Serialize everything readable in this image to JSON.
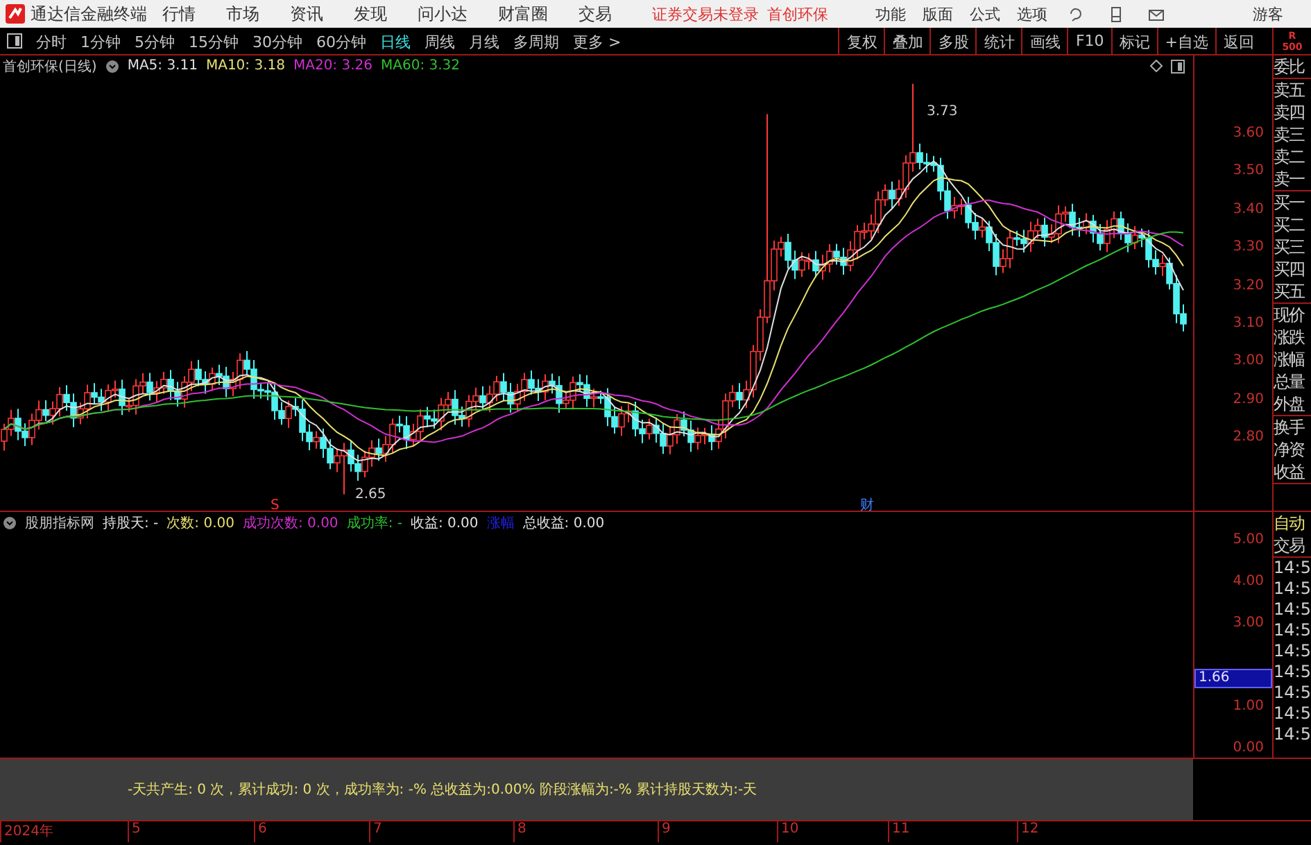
{
  "menu_bar": {
    "app_title": "通达信金融终端",
    "menus": [
      "行情",
      "市场",
      "资讯",
      "发现",
      "问小达",
      "财富圈",
      "交易"
    ],
    "login_status": "证券交易未登录",
    "stock_name": "首创环保",
    "right_menus": [
      "功能",
      "版面",
      "公式",
      "选项"
    ],
    "user": "游客"
  },
  "period_tabs": [
    {
      "label": "分时",
      "selected": false
    },
    {
      "label": "1分钟",
      "selected": false
    },
    {
      "label": "5分钟",
      "selected": false
    },
    {
      "label": "15分钟",
      "selected": false
    },
    {
      "label": "30分钟",
      "selected": false
    },
    {
      "label": "60分钟",
      "selected": false
    },
    {
      "label": "日线",
      "selected": true
    },
    {
      "label": "周线",
      "selected": false
    },
    {
      "label": "月线",
      "selected": false
    },
    {
      "label": "多周期",
      "selected": false
    },
    {
      "label": "更多 >",
      "selected": false
    }
  ],
  "toolbar_buttons": [
    "复权",
    "叠加",
    "多股",
    "统计",
    "画线",
    "F10",
    "标记",
    "+自选",
    "返回"
  ],
  "corner_badge": {
    "letter": "R",
    "number": "500"
  },
  "main_chart": {
    "title": "首创环保(日线)",
    "moving_averages": [
      {
        "label": "MA5: 3.11",
        "color": "#e0e0e0"
      },
      {
        "label": "MA10: 3.18",
        "color": "#e8e070"
      },
      {
        "label": "MA20: 3.26",
        "color": "#d030d0"
      },
      {
        "label": "MA60: 3.32",
        "color": "#30c030"
      }
    ],
    "yticks": [
      "3.60",
      "3.50",
      "3.40",
      "3.30",
      "3.20",
      "3.10",
      "3.00",
      "2.90",
      "2.80"
    ],
    "high_label": "3.73",
    "low_label": "2.65",
    "signal_marks": [
      {
        "text": "S",
        "color": "#ff3030"
      },
      {
        "text": "财",
        "color": "#4080ff"
      }
    ]
  },
  "quote_panel": {
    "groups": [
      [
        "委比"
      ],
      [
        "卖五",
        "卖四",
        "卖三",
        "卖二",
        "卖一"
      ],
      [
        "买一",
        "买二",
        "买三",
        "买四",
        "买五"
      ],
      [
        "现价",
        "涨跌",
        "涨幅",
        "总量",
        "外盘"
      ],
      [
        "换手",
        "净资",
        "收益"
      ]
    ]
  },
  "indicator": {
    "name": "股朋指标网",
    "fields": [
      {
        "text": "持股天: -",
        "color": "#e0e0e0"
      },
      {
        "text": "次数: 0.00",
        "color": "#e8e070"
      },
      {
        "text": "成功次数: 0.00",
        "color": "#d030d0"
      },
      {
        "text": "成功率: -",
        "color": "#30c030"
      },
      {
        "text": "收益: 0.00",
        "color": "#e0e0e0"
      },
      {
        "text": "涨幅",
        "color": "#2020e0"
      },
      {
        "text": "总收益: 0.00",
        "color": "#e0e0e0"
      }
    ],
    "yticks": [
      "5.00",
      "4.00",
      "3.00",
      "1.00",
      "0.00"
    ],
    "current_value": "1.66"
  },
  "trade_panel": {
    "mode": "自动",
    "title": "交易",
    "times": [
      "14:5",
      "14:5",
      "14:5",
      "14:5",
      "14:5",
      "14:5",
      "14:5",
      "14:5",
      "14:5"
    ]
  },
  "summary": "-天共产生: 0 次，累计成功: 0 次，成功率为: -% 总收益为:0.00% 阶段涨幅为:-% 累计持股天数为:-天",
  "date_axis": [
    "2024年",
    "5",
    "6",
    "7",
    "8",
    "9",
    "10",
    "11",
    "12"
  ]
}
